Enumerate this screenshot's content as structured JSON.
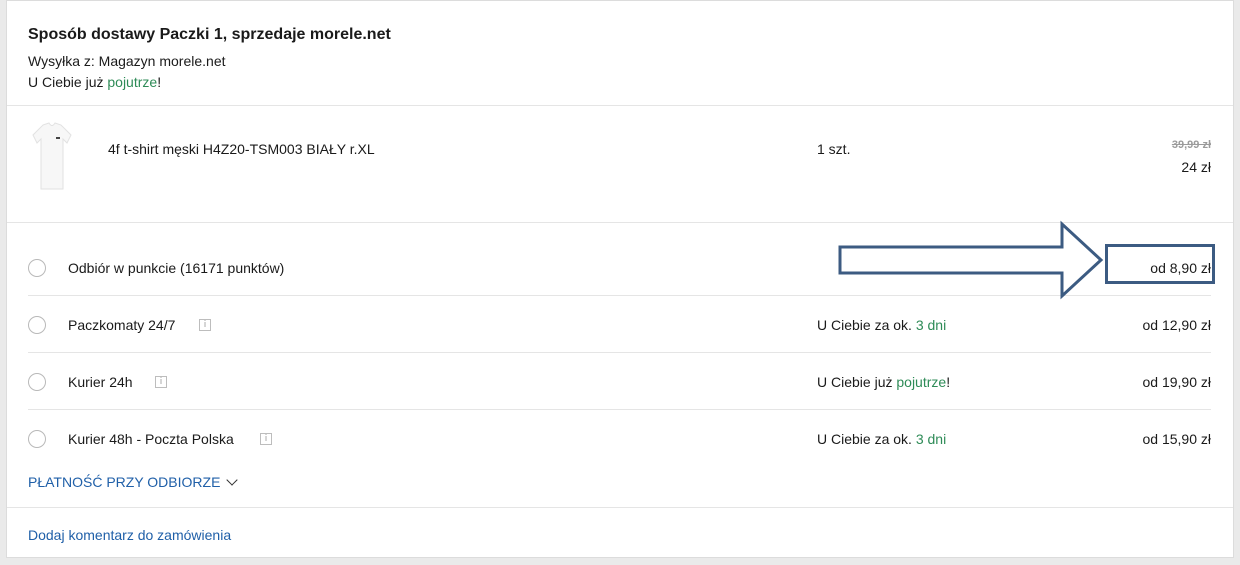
{
  "header": {
    "title": "Sposób dostawy Paczki 1, sprzedaje morele.net",
    "shipping_from": "Wysyłka z: Magazyn morele.net",
    "eta_prefix": "U Ciebie już ",
    "eta_highlight": "pojutrze",
    "eta_suffix": "!"
  },
  "product": {
    "name": "4f t-shirt męski H4Z20-TSM003 BIAŁY r.XL",
    "quantity": "1 szt.",
    "old_price": "39,99 zł",
    "price": "24 zł",
    "image_icon": "white-tshirt-image"
  },
  "delivery_options": [
    {
      "label": "Odbiór w punkcie (16171 punktów)",
      "has_info": false,
      "eta_prefix": "",
      "eta_highlight": "",
      "eta_suffix": "",
      "price": "od 8,90 zł"
    },
    {
      "label": "Paczkomaty 24/7",
      "has_info": true,
      "eta_prefix": "U Ciebie za ok. ",
      "eta_highlight": "3 dni",
      "eta_suffix": "",
      "price": "od 12,90 zł"
    },
    {
      "label": "Kurier 24h",
      "has_info": true,
      "eta_prefix": "U Ciebie już ",
      "eta_highlight": "pojutrze",
      "eta_suffix": "!",
      "price": "od 19,90 zł"
    },
    {
      "label": "Kurier 48h - Poczta Polska",
      "has_info": true,
      "eta_prefix": "U Ciebie za ok. ",
      "eta_highlight": "3 dni",
      "eta_suffix": "",
      "price": "od 15,90 zł"
    }
  ],
  "info_glyph": "i",
  "payment_toggle": "PŁATNOŚĆ PRZY ODBIORZE",
  "comment_link": "Dodaj komentarz do zamówienia",
  "colors": {
    "accent_green": "#2e8b57",
    "link_blue": "#1f5fa8",
    "annotation": "#3c5b82"
  }
}
